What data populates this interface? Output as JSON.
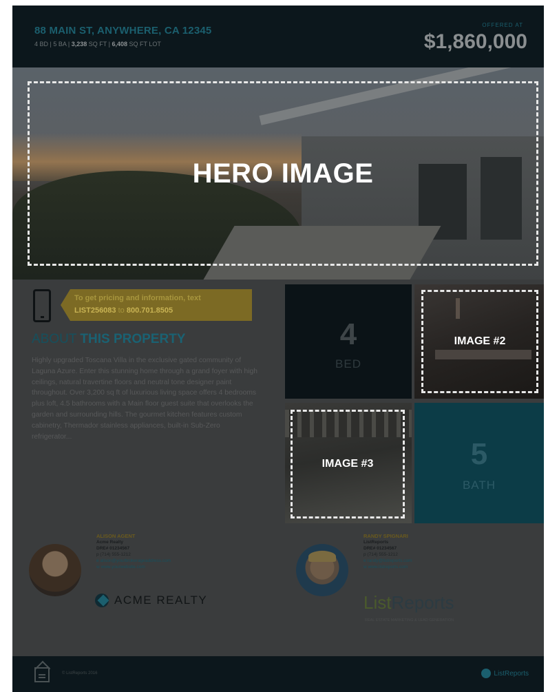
{
  "header": {
    "address": "88 MAIN ST, ANYWHERE, CA 12345",
    "specs_beds": "4 BD",
    "specs_baths": "5 BA",
    "specs_sqft_value": "3,238",
    "specs_sqft_unit": "SQ FT",
    "specs_lot_value": "6,408",
    "specs_lot_unit": "SQ FT LOT",
    "price_label": "OFFERED AT",
    "price": "$1,860,000"
  },
  "hero": {
    "placeholder": "HERO IMAGE"
  },
  "callout": {
    "line1": "To get pricing and information, text",
    "code": "LIST256083",
    "to_word": "to",
    "number": "800.701.8505"
  },
  "about": {
    "title_part1": "ABOUT",
    "title_part2": "THIS PROPERTY",
    "description": "Highly upgraded Toscana Villa in the exclusive gated community of Laguna Azure. Enter this stunning home through a grand foyer with high ceilings, natural travertine floors and neutral tone designer paint throughout. Over 3,200 sq ft of luxurious living space offers 4 bedrooms plus loft, 4.5 bathrooms with a Main floor guest suite that overlooks the garden and surrounding hills. The gourmet kitchen features custom cabinetry, Thermador stainless appliances, built-in Sub-Zero refrigerator..."
  },
  "tiles": {
    "beds_value": "4",
    "beds_label": "BED",
    "image2_placeholder": "IMAGE #2",
    "image3_placeholder": "IMAGE #3",
    "baths_value": "5",
    "baths_label": "BATH"
  },
  "agent1": {
    "name": "ALISON AGENT",
    "company": "Acme Realty",
    "license": "DRE# 01234567",
    "phone": "p (714) 555-1212",
    "email": "e alison@yourbrokerageaddress.com",
    "web": "w www.yourwebsite.com",
    "logo_text": "ACME REALTY"
  },
  "agent2": {
    "name": "RANDY SPIGNARI",
    "company": "ListReports",
    "license": "DRE# 01234567",
    "phone": "p (714) 555-1212",
    "email": "e randy@listreports.com",
    "web": "w www.listreports.com",
    "logo_part1": "List",
    "logo_part2": "Reports",
    "logo_sub": "REAL ESTATE MARKETING & LEAD GENERATION"
  },
  "footer": {
    "copyright": "© ListReports 2016",
    "logo_text": "ListReports"
  }
}
